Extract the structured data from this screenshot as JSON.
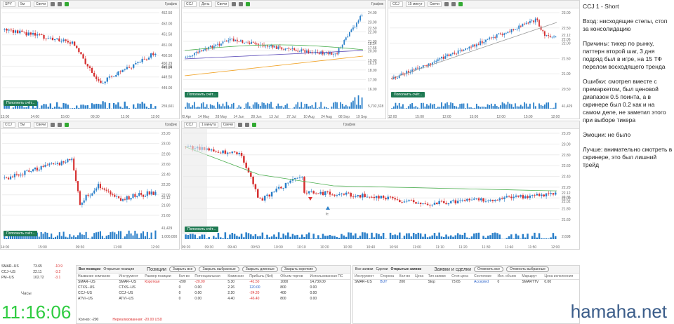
{
  "panels": {
    "spy": {
      "symbol": "SPY",
      "interval": "5м",
      "type": "Свечи",
      "label": "График",
      "yticks": [
        "452.50",
        "452.00",
        "451.50",
        "451.00",
        "450.50",
        "450.00",
        "449.50",
        "449.00"
      ],
      "xticks": [
        "13:00",
        "14:00",
        "15:00",
        "09:30",
        "11:00",
        "12:00"
      ],
      "price_tags": [
        "450.29",
        "449.84"
      ],
      "volume_label": "259,601",
      "btn": "Пополнить счёт..."
    },
    "ccj_day": {
      "symbol": "CCJ",
      "interval": "День",
      "type": "Свечи",
      "label": "График",
      "yticks": [
        "24.00",
        "23.00",
        "22.00",
        "21.00",
        "20.00",
        "19.00",
        "18.00",
        "17.00",
        "16.00"
      ],
      "price_tags": [
        "22.50",
        "18.54",
        "17.56",
        "16.19"
      ],
      "xticks": [
        "20 Apr",
        "14 May",
        "28 May",
        "14 Jun",
        "28 Jun",
        "13 Jul",
        "27 Jul",
        "10 Aug",
        "24 Aug",
        "08 Sep",
        "19 Sep"
      ],
      "volume_label": "5,702,328",
      "btn": "Пополнить счёт..."
    },
    "ccj_15": {
      "symbol": "CCJ",
      "interval": "15 минут",
      "type": "Свечи",
      "label": "",
      "yticks": [
        "23.00",
        "22.50",
        "22.00",
        "21.50",
        "21.00",
        "20.50"
      ],
      "price_tags": [
        "22.12",
        "22.06"
      ],
      "xticks": [
        "12:00",
        "15:00",
        "12:00",
        "15:00",
        "12:00",
        "15:00",
        "12:00"
      ],
      "volume_label": "41,429",
      "btn": "Пополнить счёт..."
    },
    "ccj_5": {
      "symbol": "CCJ",
      "interval": "5м",
      "type": "Свечи",
      "label": "График",
      "yticks": [
        "23.20",
        "23.00",
        "22.80",
        "22.60",
        "22.40",
        "22.20",
        "22.00",
        "21.80",
        "21.60"
      ],
      "price_tags": [
        "22.12"
      ],
      "xticks": [
        "14:00",
        "15:00",
        "09:30",
        "11:00",
        "12:00"
      ],
      "volume_label": "1,000,000",
      "volume_label2": "41,429",
      "btn": "Пополнить счёт..."
    },
    "ccj_1": {
      "symbol": "CCJ",
      "interval": "1 минута",
      "type": "Свечи",
      "label": "График",
      "yticks": [
        "23.20",
        "23.00",
        "22.80",
        "22.60",
        "22.40",
        "22.20",
        "22.00",
        "21.80",
        "21.60"
      ],
      "price_tags": [
        "22.12",
        "22.06",
        "22.02"
      ],
      "xticks": [
        "09:20",
        "09:30",
        "09:40",
        "09:50",
        "10:00",
        "10:10",
        "10:20",
        "10:30",
        "10:40",
        "10:50",
        "11:00",
        "11:10",
        "11:20",
        "11:30",
        "11:40",
        "11:50",
        "12:00"
      ],
      "volume_label": "2,698",
      "btn": "Пополнить счёт...",
      "annotation": "fc"
    }
  },
  "watchlist": [
    {
      "sym": "SMAR--US",
      "price": "73.65",
      "chg": "-10.9"
    },
    {
      "sym": "CCJ--US",
      "price": "22.11",
      "chg": "-3.2"
    },
    {
      "sym": "PM--US",
      "price": "102.72",
      "chg": "-3.1"
    }
  ],
  "clock": {
    "label": "Часы",
    "time": "11:16:06"
  },
  "positions": {
    "tabs": [
      "Все позиции",
      "Открытые позиции"
    ],
    "section": "Позиции",
    "buttons": [
      "Закрыть все",
      "Закрыть выбранные",
      "Закрыть длинные",
      "Закрыть короткие"
    ],
    "headers": [
      "Название компании",
      "Инструмент",
      "Размер позиции",
      "Кол-во",
      "Потенциальная",
      "Комиссии",
      "Прибыль (Net)",
      "Объем торгов",
      "Использованная ПС"
    ],
    "rows": [
      [
        "SMAR--US",
        "SMAR--US",
        "Короткая",
        "-200",
        "-20.00",
        "5.30",
        "-41.50",
        "1000",
        "14,730.00"
      ],
      [
        "CTXS--US",
        "CTXS--US",
        "",
        "0",
        "0.00",
        "2.26",
        "120.00",
        "800",
        "0.00"
      ],
      [
        "CCJ--US",
        "CCJ--US",
        "",
        "0",
        "0.00",
        "2.20",
        "-24.20",
        "400",
        "0.00"
      ],
      [
        "ATVI--US",
        "ATVI--US",
        "",
        "0",
        "0.00",
        "4.40",
        "-46.40",
        "800",
        "0.00"
      ]
    ],
    "footer_qty": "Кол-во: -200",
    "footer_unreal": "Нереализованная: -20.00 USD"
  },
  "orders": {
    "tabs": [
      "Все заявки",
      "Сделки",
      "Открытые заявки"
    ],
    "section": "Заявки и сделки",
    "buttons": [
      "Отменить все",
      "Отменить выбранные"
    ],
    "headers": [
      "Инструмент",
      "Сторона",
      "Кол-во",
      "Цена",
      "Тип заявки",
      "Стоп цена",
      "Состояние",
      "Исп. объем",
      "Маршрут",
      "Цена исполнения"
    ],
    "rows": [
      [
        "SMAR--US",
        "BUY",
        "200",
        "",
        "Stop",
        "73.65",
        "Accepted",
        "0",
        "SMARTTV",
        "0.00"
      ]
    ]
  },
  "notes": {
    "title": "CCJ 1 - Short",
    "entry": "Вход: нисходящие степы, стоп за консолидацию",
    "reasons": "Причины: тикер по рынку, паттерн второй шаг, 3 дня подряд был в игре, на 15 ТФ перелом восходящего тренда",
    "errors": "Ошибки: смотрел вместе с премаркетом, был ценовой диапазон 0.5 поинта, а в скринере был 0.2 как и на самом деле, не заметил этого при выборе тикера",
    "emotions": "Эмоции: не было",
    "better": "Лучше: внимательно смотреть в скринере, это был лишний трейд"
  },
  "watermark": "hamaha.net",
  "colors": {
    "up": "#2a7fc9",
    "down": "#d63030",
    "ma_green": "#4caf50",
    "ma_purple": "#5b4bb7",
    "ma_orange": "#f0a020",
    "button": "#1f7a53"
  }
}
